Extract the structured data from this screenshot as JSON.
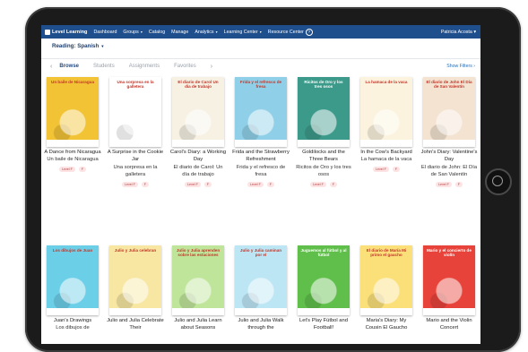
{
  "nav": {
    "logo": "Level Learning",
    "items": [
      "Dashboard",
      "Groups",
      "Catalog",
      "Manage",
      "Analytics",
      "Learning Center",
      "Resource Center"
    ],
    "help": "?",
    "user": "Patricia Acosta"
  },
  "reading_filter": "Reading: Spanish",
  "tabs": [
    "Browse",
    "Students",
    "Assignments",
    "Favorites"
  ],
  "show_filters": "Show Filters",
  "books_row1": [
    {
      "title": "A Dance from Nicaragua",
      "subtitle": "Un baile de Nicaragua",
      "cover_text": "Un baile de Nicaragua",
      "level": "Level F",
      "tag": "F",
      "color": "#f2c335"
    },
    {
      "title": "A Surprise in the Cookie Jar",
      "subtitle": "Una sorpresa en la galletera",
      "cover_text": "Una sorpresa en la galletera",
      "level": "Level F",
      "tag": "F",
      "color": "#ffffff"
    },
    {
      "title": "Carol's Diary: a Working Day",
      "subtitle": "El diario de Carol: Un día de trabajo",
      "cover_text": "El diario de Carol Un día de trabajo",
      "level": "Level F",
      "tag": "F",
      "color": "#f7f1e4"
    },
    {
      "title": "Frida and the Strawberry Refreshment",
      "subtitle": "Frida y el refresco de fresa",
      "cover_text": "Frida y el refresco de fresa",
      "level": "Level F",
      "tag": "F",
      "color": "#8fd0e8"
    },
    {
      "title": "Goldilocks and the Three Bears",
      "subtitle": "Ricitos de Oro y los tres osos",
      "cover_text": "Ricitos de Oro y los tres osos",
      "level": "Level F",
      "tag": "F",
      "color": "#3c9a8a"
    },
    {
      "title": "In the Cow's Backyard",
      "subtitle": "La hamaca de la vaca",
      "cover_text": "La hamaca de la vaca",
      "level": "Level F",
      "tag": "F",
      "color": "#fbf3de"
    },
    {
      "title": "John's Diary: Valentine's Day",
      "subtitle": "El diario de John: El Día de San Valentín",
      "cover_text": "El diario de John El Día de San Valentín",
      "level": "Level F",
      "tag": "F",
      "color": "#f3e3d0"
    }
  ],
  "books_row2": [
    {
      "title": "Juan's Drawings",
      "subtitle": "Los dibujos de",
      "cover_text": "Los dibujos de Juan",
      "color": "#6ccfe8"
    },
    {
      "title": "Julio and Julia Celebrate Their",
      "subtitle": "",
      "cover_text": "Julio y Julia celebran",
      "color": "#f7e7a2"
    },
    {
      "title": "Julio and Julia Learn about Seasons",
      "subtitle": "",
      "cover_text": "Julio y Julia aprenden sobre las estaciones",
      "color": "#bfe59a"
    },
    {
      "title": "Julio and Julia Walk through the",
      "subtitle": "",
      "cover_text": "Julio y Julia caminan por el",
      "color": "#bde6f5"
    },
    {
      "title": "Let's Play Fútbol and Football!",
      "subtitle": "",
      "cover_text": "Juguemos al fútbol y al fútbol",
      "color": "#5fbf4a"
    },
    {
      "title": "Maria's Diary: My Cousin El Gaucho",
      "subtitle": "",
      "cover_text": "El diario de María Mi primo el gaucho",
      "color": "#fbe07a"
    },
    {
      "title": "Mario and the Violin Concert",
      "subtitle": "",
      "cover_text": "Mario y el concierto de violín",
      "color": "#e8433a"
    }
  ]
}
